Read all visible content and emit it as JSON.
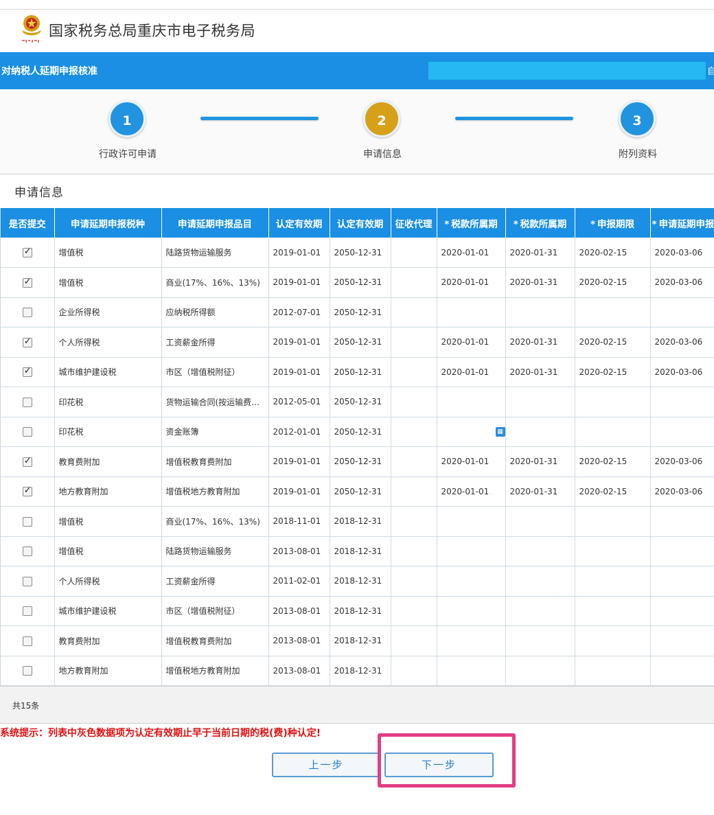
{
  "header": {
    "site_title": "国家税务总局重庆市电子税务局"
  },
  "bluebar": {
    "title": "对纳税人延期申报核准",
    "edge_text": "自"
  },
  "steps": [
    {
      "number": "1",
      "label": "行政许可申请"
    },
    {
      "number": "2",
      "label": "申请信息"
    },
    {
      "number": "3",
      "label": "附列资料"
    }
  ],
  "section_title": "申请信息",
  "table": {
    "columns": [
      "是否提交",
      "申请延期申报税种",
      "申请延期申报品目",
      "认定有效期",
      "认定有效期",
      "征收代理",
      "税款所属期",
      "税款所属期",
      "申报期限",
      "申请延期申报"
    ],
    "required_mark": "*",
    "rows": [
      {
        "checked": true,
        "tax": "增值税",
        "item": "陆路货物运输服务",
        "from": "2019-01-01",
        "to": "2050-12-31",
        "agent": "",
        "p1": "2020-01-01",
        "p2": "2020-01-31",
        "deadline": "2020-02-15",
        "ext": "2020-03-06"
      },
      {
        "checked": true,
        "tax": "增值税",
        "item": "商业(17%、16%、13%)",
        "from": "2019-01-01",
        "to": "2050-12-31",
        "agent": "",
        "p1": "2020-01-01",
        "p2": "2020-01-31",
        "deadline": "2020-02-15",
        "ext": "2020-03-06"
      },
      {
        "checked": false,
        "tax": "企业所得税",
        "item": "应纳税所得额",
        "from": "2012-07-01",
        "to": "2050-12-31",
        "agent": "",
        "p1": "",
        "p2": "",
        "deadline": "",
        "ext": ""
      },
      {
        "checked": true,
        "tax": "个人所得税",
        "item": "工资薪金所得",
        "from": "2019-01-01",
        "to": "2050-12-31",
        "agent": "",
        "p1": "2020-01-01",
        "p2": "2020-01-31",
        "deadline": "2020-02-15",
        "ext": "2020-03-06"
      },
      {
        "checked": true,
        "tax": "城市维护建设税",
        "item": "市区（增值税附征）",
        "from": "2019-01-01",
        "to": "2050-12-31",
        "agent": "",
        "p1": "2020-01-01",
        "p2": "2020-01-31",
        "deadline": "2020-02-15",
        "ext": "2020-03-06"
      },
      {
        "checked": false,
        "tax": "印花税",
        "item": "货物运输合同(按运输费…",
        "from": "2012-05-01",
        "to": "2050-12-31",
        "agent": "",
        "p1": "",
        "p2": "",
        "deadline": "",
        "ext": ""
      },
      {
        "checked": false,
        "tax": "印花税",
        "item": "资金账簿",
        "from": "2012-01-01",
        "to": "2050-12-31",
        "agent": "",
        "p1": "",
        "p2": "",
        "deadline": "",
        "ext": "",
        "calendar": true
      },
      {
        "checked": true,
        "tax": "教育费附加",
        "item": "增值税教育费附加",
        "from": "2019-01-01",
        "to": "2050-12-31",
        "agent": "",
        "p1": "2020-01-01",
        "p2": "2020-01-31",
        "deadline": "2020-02-15",
        "ext": "2020-03-06"
      },
      {
        "checked": true,
        "tax": "地方教育附加",
        "item": "增值税地方教育附加",
        "from": "2019-01-01",
        "to": "2050-12-31",
        "agent": "",
        "p1": "2020-01-01",
        "p2": "2020-01-31",
        "deadline": "2020-02-15",
        "ext": "2020-03-06"
      },
      {
        "checked": false,
        "tax": "增值税",
        "item": "商业(17%、16%、13%)",
        "from": "2018-11-01",
        "to": "2018-12-31",
        "agent": "",
        "p1": "",
        "p2": "",
        "deadline": "",
        "ext": ""
      },
      {
        "checked": false,
        "tax": "增值税",
        "item": "陆路货物运输服务",
        "from": "2013-08-01",
        "to": "2018-12-31",
        "agent": "",
        "p1": "",
        "p2": "",
        "deadline": "",
        "ext": ""
      },
      {
        "checked": false,
        "tax": "个人所得税",
        "item": "工资薪金所得",
        "from": "2011-02-01",
        "to": "2018-12-31",
        "agent": "",
        "p1": "",
        "p2": "",
        "deadline": "",
        "ext": ""
      },
      {
        "checked": false,
        "tax": "城市维护建设税",
        "item": "市区（增值税附征）",
        "from": "2013-08-01",
        "to": "2018-12-31",
        "agent": "",
        "p1": "",
        "p2": "",
        "deadline": "",
        "ext": ""
      },
      {
        "checked": false,
        "tax": "教育费附加",
        "item": "增值税教育费附加",
        "from": "2013-08-01",
        "to": "2018-12-31",
        "agent": "",
        "p1": "",
        "p2": "",
        "deadline": "",
        "ext": ""
      },
      {
        "checked": false,
        "tax": "地方教育附加",
        "item": "增值税地方教育附加",
        "from": "2013-08-01",
        "to": "2018-12-31",
        "agent": "",
        "p1": "",
        "p2": "",
        "deadline": "",
        "ext": ""
      }
    ]
  },
  "footer": {
    "count_text": "共15条"
  },
  "hint": "系统提示：列表中灰色数据项为认定有效期止早于当前日期的税(费)种认定!",
  "buttons": {
    "prev": "上一步",
    "next": "下一步"
  },
  "colors": {
    "primary_blue": "#1a8fe3",
    "step_gold": "#d7a019",
    "hint_red": "#e01010",
    "highlight_pink": "#e23d86"
  }
}
